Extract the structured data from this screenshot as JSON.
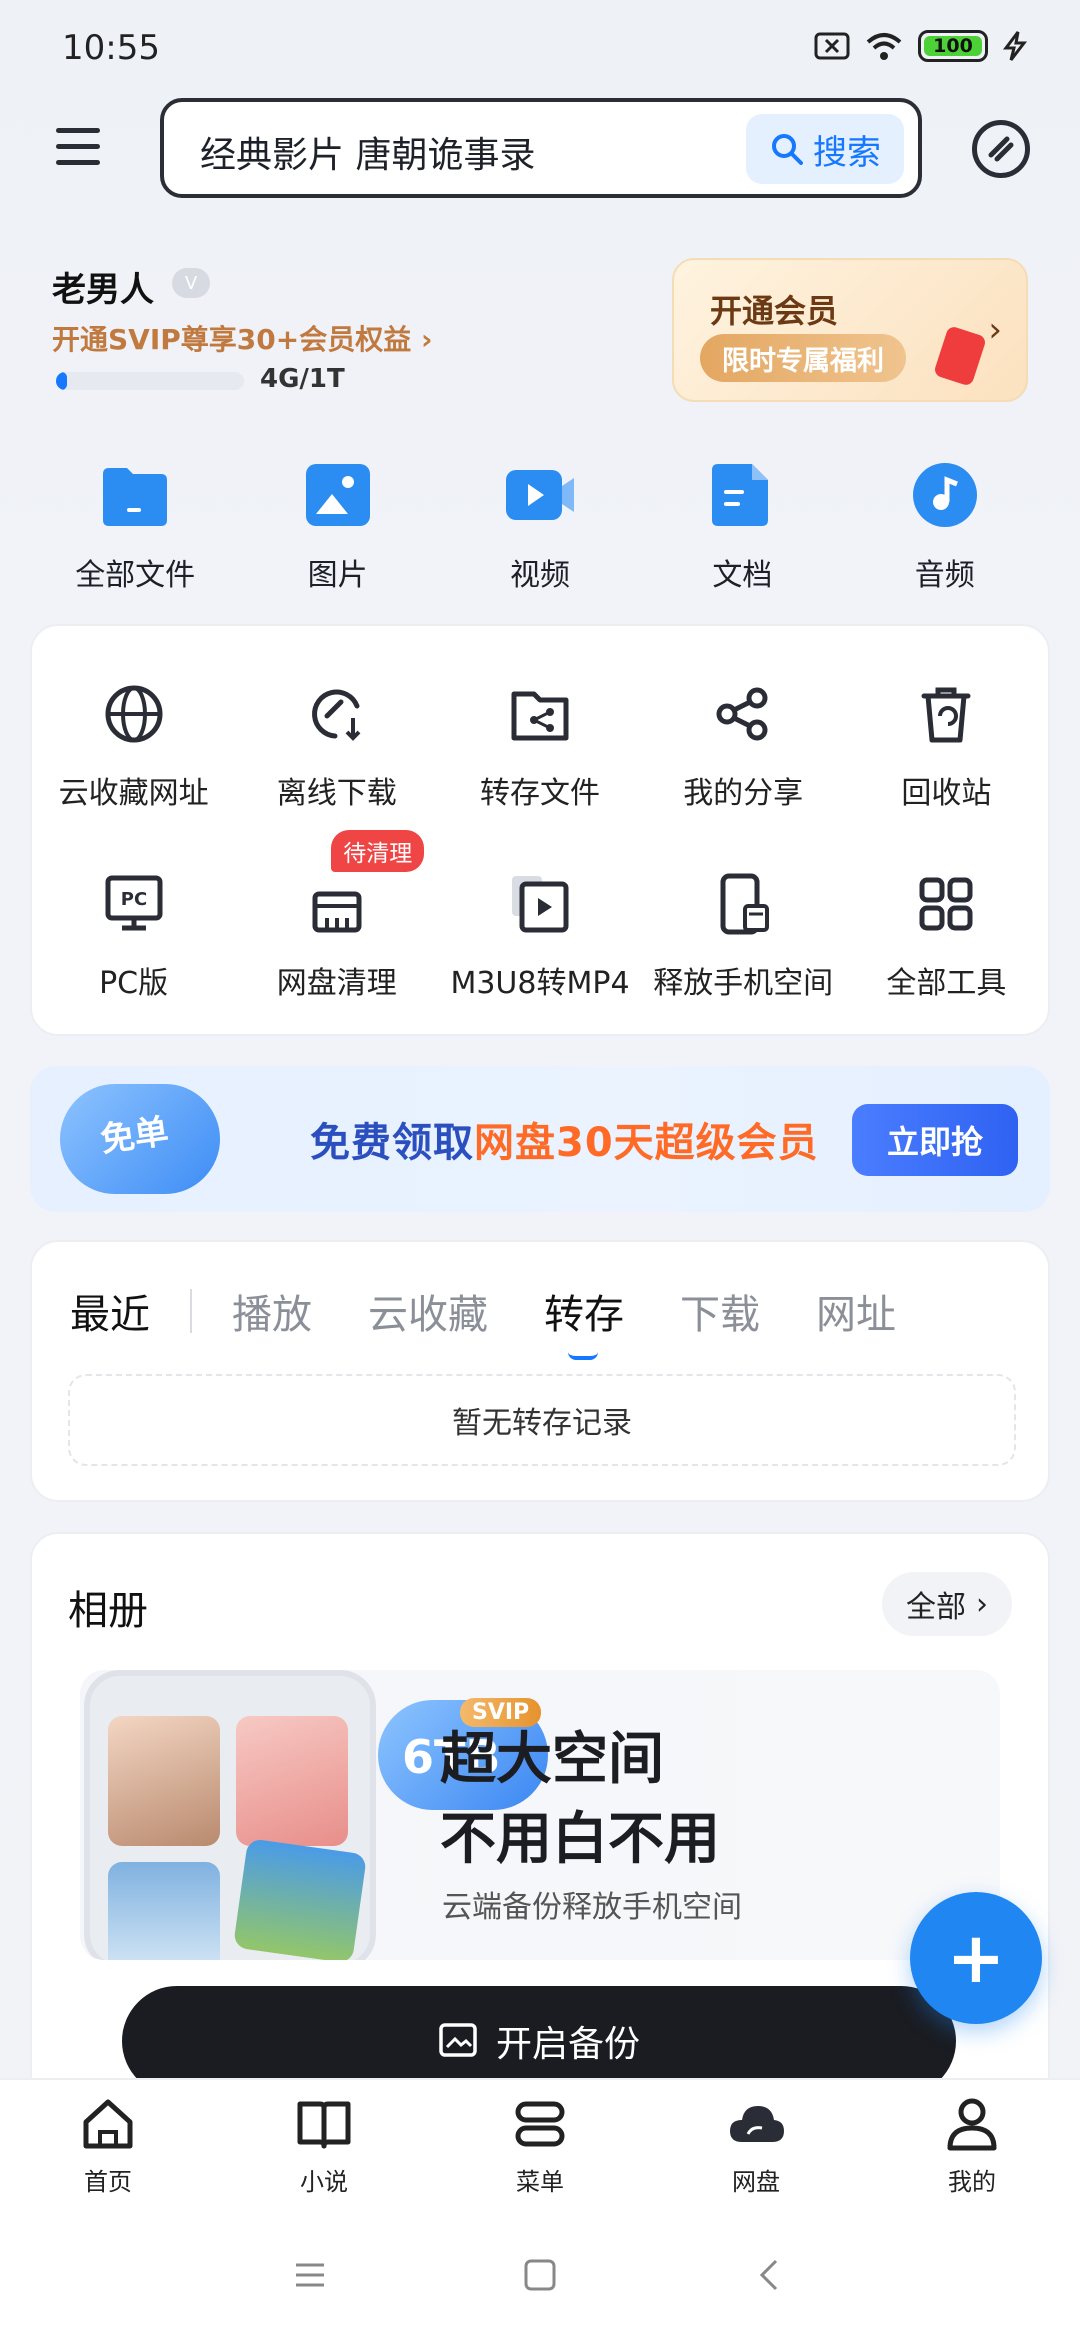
{
  "status_bar": {
    "time": "10:55",
    "battery": "100",
    "battery_level": 1.0
  },
  "search": {
    "query": "经典影片 唐朝诡事录",
    "button_label": "搜索"
  },
  "account": {
    "username": "老男人",
    "level_badge": "V",
    "svip_promo": "开通SVIP尊享30+会员权益",
    "quota_text": "4G/1T",
    "quota_fraction": 0.004
  },
  "vip_card": {
    "title": "开通会员",
    "subtitle": "限时专属福利"
  },
  "categories": [
    {
      "label": "全部文件",
      "icon": "folder-icon"
    },
    {
      "label": "图片",
      "icon": "image-icon"
    },
    {
      "label": "视频",
      "icon": "video-icon"
    },
    {
      "label": "文档",
      "icon": "document-icon"
    },
    {
      "label": "音频",
      "icon": "music-icon"
    }
  ],
  "tools": [
    {
      "label": "云收藏网址",
      "icon": "globe-icon"
    },
    {
      "label": "离线下载",
      "icon": "offline-download-icon"
    },
    {
      "label": "转存文件",
      "icon": "transfer-folder-icon"
    },
    {
      "label": "我的分享",
      "icon": "share-icon"
    },
    {
      "label": "回收站",
      "icon": "trash-icon"
    },
    {
      "label": "PC版",
      "icon": "pc-icon"
    },
    {
      "label": "网盘清理",
      "icon": "broom-icon",
      "badge": "待清理"
    },
    {
      "label": "M3U8转MP4",
      "icon": "convert-video-icon"
    },
    {
      "label": "释放手机空间",
      "icon": "phone-clean-icon"
    },
    {
      "label": "全部工具",
      "icon": "grid-icon"
    }
  ],
  "banner": {
    "cloud_text": "免单",
    "text_prefix": "免费领取",
    "text_highlight": "网盘30天超级会员",
    "button_label": "立即抢"
  },
  "recent": {
    "tabs": [
      "最近",
      "播放",
      "云收藏",
      "转存",
      "下载",
      "网址"
    ],
    "selected_tab": "转存",
    "empty_text": "暂无转存记录"
  },
  "album": {
    "title": "相册",
    "all_label": "全部",
    "promo_badge": "SVIP",
    "promo_capacity": "6TB",
    "promo_line1": "超大空间",
    "promo_line2": "不用白不用",
    "promo_sub": "云端备份释放手机空间",
    "backup_button": "开启备份"
  },
  "fab": {
    "label": "+"
  },
  "bottom_nav": [
    {
      "label": "首页",
      "icon": "home-icon"
    },
    {
      "label": "小说",
      "icon": "book-icon"
    },
    {
      "label": "菜单",
      "icon": "menu-icon"
    },
    {
      "label": "网盘",
      "icon": "cloud-icon"
    },
    {
      "label": "我的",
      "icon": "user-icon"
    }
  ],
  "colors": {
    "accent": "#1677ff",
    "gold": "#c07a3f",
    "dark": "#1a1c22"
  }
}
